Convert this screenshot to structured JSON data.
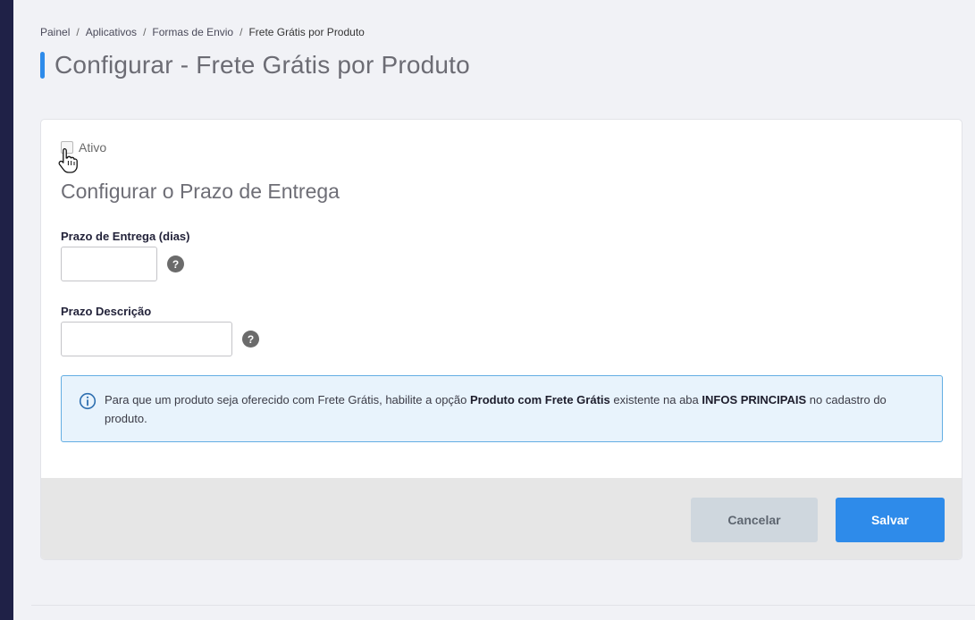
{
  "breadcrumb": {
    "items": [
      "Painel",
      "Aplicativos",
      "Formas de Envio"
    ],
    "separator": "/",
    "current": "Frete Grátis por Produto"
  },
  "page": {
    "title": "Configurar - Frete Grátis por Produto"
  },
  "form": {
    "active_label": "Ativo",
    "active_checked": false,
    "section_title": "Configurar o Prazo de Entrega",
    "fields": [
      {
        "label": "Prazo de Entrega (dias)",
        "value": "",
        "help": "?"
      },
      {
        "label": "Prazo Descrição",
        "value": "",
        "help": "?"
      }
    ]
  },
  "info": {
    "text_1": "Para que um produto seja oferecido com Frete Grátis, habilite a opção ",
    "bold_1": "Produto com Frete Grátis",
    "text_2": " existente na aba ",
    "bold_2": "INFOS PRINCIPAIS",
    "text_3": " no cadastro do produto."
  },
  "actions": {
    "cancel_label": "Cancelar",
    "save_label": "Salvar"
  },
  "colors": {
    "accent": "#2e8bea",
    "sidebar": "#1f2147",
    "info_bg": "#e8f3fc",
    "info_border": "#63aee3"
  },
  "icons": {
    "help": "question-circle-icon",
    "info": "info-circle-icon",
    "cursor": "hand-pointer-icon"
  }
}
